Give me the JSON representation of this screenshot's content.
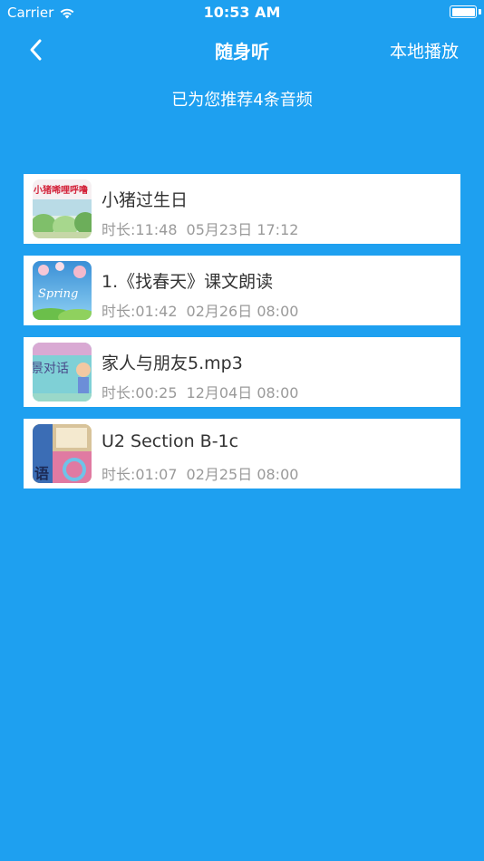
{
  "status_bar": {
    "carrier": "Carrier",
    "time": "10:53 AM",
    "wifi_icon": "wifi-icon",
    "battery_icon": "battery-icon"
  },
  "nav": {
    "back_icon": "chevron-left-icon",
    "title": "随身听",
    "right_action": "本地播放"
  },
  "subtitle": "已为您推荐4条音频",
  "audio_items": [
    {
      "title": "小猪过生日",
      "duration": "时长:11:48",
      "date": "05月23日 17:12",
      "thumb_text": "小猪唏哩呼噜"
    },
    {
      "title": "1.《找春天》课文朗读",
      "duration": "时长:01:42",
      "date": "02月26日 08:00",
      "thumb_text": "Spring"
    },
    {
      "title": "家人与朋友5.mp3",
      "duration": "时长:00:25",
      "date": "12月04日 08:00",
      "thumb_text": "景对话"
    },
    {
      "title": "U2 Section B-1c",
      "duration": "时长:01:07",
      "date": "02月25日 08:00",
      "thumb_text": "语"
    }
  ],
  "colors": {
    "background": "#1ea0f0",
    "card": "#ffffff",
    "title_text": "#333333",
    "meta_text": "#9a9a9a"
  }
}
